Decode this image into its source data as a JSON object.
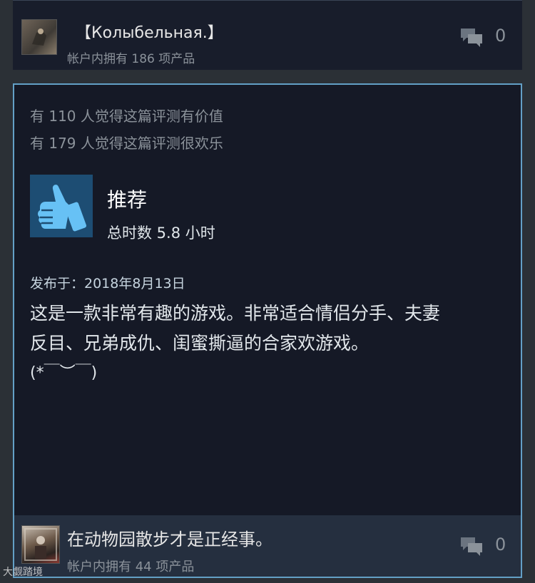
{
  "top_user": {
    "name": "【Колыбельная.】",
    "owned": "帐户内拥有 186 项产品",
    "comment_count": "0"
  },
  "review": {
    "helpful": "有 110 人觉得这篇评测有价值",
    "funny": "有 179 人觉得这篇评测很欢乐",
    "recommendation": "推荐",
    "hours": "总时数 5.8 小时",
    "posted": "发布于：2018年8月13日",
    "text_lines": [
      "这是一款非常有趣的游戏。非常适合情侣分手、夫妻",
      "反目、兄弟成仇、闺蜜撕逼的合家欢游戏。",
      "(*￣︶￣)"
    ],
    "author": {
      "name": "在动物园散步才是正经事。",
      "owned": "帐户内拥有 44 项产品",
      "comment_count": "0"
    }
  },
  "watermark": "大觑踏境",
  "colors": {
    "accent_border": "#63a0c6",
    "thumb_bg": "#1d4d73",
    "thumb_fg": "#67c1f5"
  }
}
